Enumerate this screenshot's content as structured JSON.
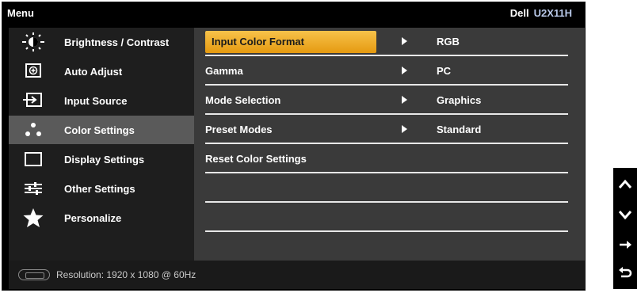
{
  "title": {
    "menu": "Menu",
    "brand": "Dell",
    "model": "U2X11H"
  },
  "sidebar": {
    "items": [
      {
        "label": "Brightness / Contrast",
        "icon": "brightness-icon"
      },
      {
        "label": "Auto Adjust",
        "icon": "auto-adjust-icon"
      },
      {
        "label": "Input Source",
        "icon": "input-source-icon"
      },
      {
        "label": "Color Settings",
        "icon": "color-settings-icon",
        "selected": true
      },
      {
        "label": "Display Settings",
        "icon": "display-settings-icon"
      },
      {
        "label": "Other Settings",
        "icon": "other-settings-icon"
      },
      {
        "label": "Personalize",
        "icon": "star-icon"
      }
    ]
  },
  "content": {
    "rows": [
      {
        "label": "Input Color Format",
        "value": "RGB",
        "highlighted": true
      },
      {
        "label": "Gamma",
        "value": "PC"
      },
      {
        "label": "Mode Selection",
        "value": "Graphics"
      },
      {
        "label": "Preset Modes",
        "value": "Standard"
      },
      {
        "label": "Reset Color Settings",
        "value": ""
      }
    ]
  },
  "status": {
    "text": "Resolution: 1920 x 1080 @ 60Hz",
    "icon": "vga-icon"
  },
  "nav": {
    "buttons": [
      "up-icon",
      "down-icon",
      "enter-icon",
      "back-icon"
    ]
  },
  "colors": {
    "highlight": "#f0aa2a",
    "panel": "#3a3a3a",
    "sidebar": "#1e1e1e",
    "selected": "#5a5a5a"
  }
}
